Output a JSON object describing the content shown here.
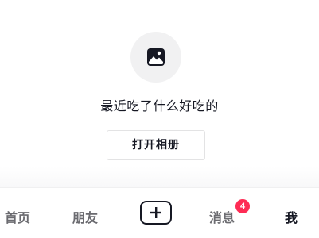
{
  "empty_state": {
    "icon": "image-icon",
    "prompt": "最近吃了什么好吃的",
    "button_label": "打开相册"
  },
  "tabbar": {
    "tabs": [
      {
        "label": "首页"
      },
      {
        "label": "朋友"
      },
      {
        "label": "消息",
        "badge": "4"
      },
      {
        "label": "我"
      }
    ],
    "plus_icon": "plus-icon"
  },
  "colors": {
    "text_primary": "#161823",
    "text_secondary": "#6b6b70",
    "badge": "#fe2c55",
    "icon_bg": "#f1f1f2"
  }
}
